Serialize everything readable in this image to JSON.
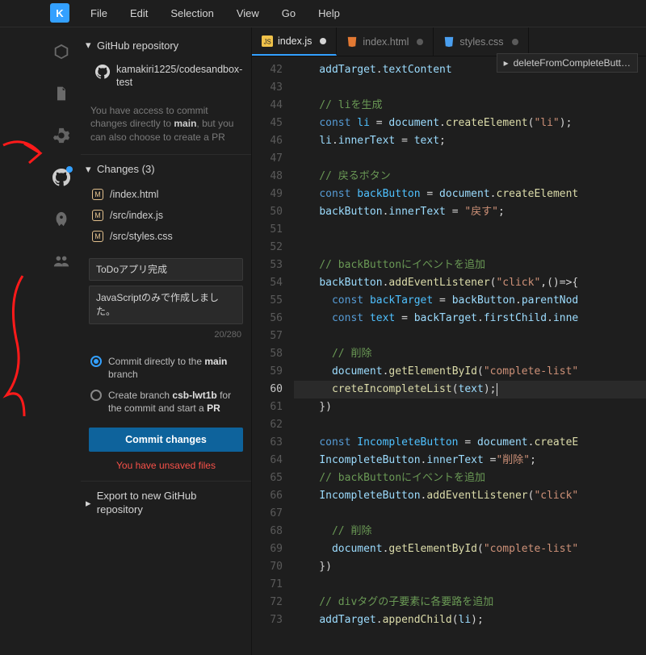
{
  "menubar": {
    "logo": "K",
    "items": [
      "File",
      "Edit",
      "Selection",
      "View",
      "Go",
      "Help"
    ]
  },
  "activity": {
    "icons": [
      {
        "name": "cube-icon"
      },
      {
        "name": "file-icon"
      },
      {
        "name": "gear-icon"
      },
      {
        "name": "github-icon",
        "active": true,
        "notif": true
      },
      {
        "name": "rocket-icon"
      },
      {
        "name": "users-icon"
      }
    ]
  },
  "sidebar": {
    "github_header": "GitHub repository",
    "repo": "kamakiri1225/codesandbox-test",
    "info_pre": "You have access to commit changes directly to ",
    "info_main": "main",
    "info_post": ", but you can also choose to create a PR",
    "changes_header": "Changes (3)",
    "changes": [
      {
        "badge": "M",
        "path": "/index.html"
      },
      {
        "badge": "M",
        "path": "/src/index.js"
      },
      {
        "badge": "M",
        "path": "/src/styles.css"
      }
    ],
    "commit_title": "ToDoアプリ完成",
    "commit_desc": "JavaScriptのみで作成しました。",
    "char_count": "20/280",
    "radio1_pre": "Commit directly to the ",
    "radio1_b": "main",
    "radio1_post": " branch",
    "radio2_pre": "Create branch ",
    "radio2_b": "csb-lwt1b",
    "radio2_mid": " for the commit and start a ",
    "radio2_b2": "PR",
    "commit_btn": "Commit changes",
    "warn": "You have unsaved files",
    "export_header": "Export to new GitHub repository"
  },
  "tabs": [
    {
      "label": "index.js",
      "active": true,
      "kind": "js"
    },
    {
      "label": "index.html",
      "active": false,
      "kind": "html"
    },
    {
      "label": "styles.css",
      "active": false,
      "kind": "css"
    }
  ],
  "breadcrumb": "deleteFromCompleteButt…",
  "code": {
    "start": 42,
    "active_line": 60,
    "lines": [
      {
        "n": 42,
        "t": [
          {
            "c": "var",
            "s": "    addTarget"
          },
          {
            "c": "plain",
            "s": "."
          },
          {
            "c": "var",
            "s": "textContent"
          }
        ]
      },
      {
        "n": 43,
        "t": []
      },
      {
        "n": 44,
        "t": [
          {
            "c": "cmt",
            "s": "    // liを生成"
          }
        ]
      },
      {
        "n": 45,
        "t": [
          {
            "c": "plain",
            "s": "    "
          },
          {
            "c": "kw2",
            "s": "const "
          },
          {
            "c": "obj",
            "s": "li"
          },
          {
            "c": "plain",
            "s": " = "
          },
          {
            "c": "var",
            "s": "document"
          },
          {
            "c": "plain",
            "s": "."
          },
          {
            "c": "fn",
            "s": "createElement"
          },
          {
            "c": "plain",
            "s": "("
          },
          {
            "c": "str",
            "s": "\"li\""
          },
          {
            "c": "plain",
            "s": ");"
          }
        ]
      },
      {
        "n": 46,
        "t": [
          {
            "c": "plain",
            "s": "    "
          },
          {
            "c": "var",
            "s": "li"
          },
          {
            "c": "plain",
            "s": "."
          },
          {
            "c": "var",
            "s": "innerText"
          },
          {
            "c": "plain",
            "s": " = "
          },
          {
            "c": "var",
            "s": "text"
          },
          {
            "c": "plain",
            "s": ";"
          }
        ]
      },
      {
        "n": 47,
        "t": []
      },
      {
        "n": 48,
        "t": [
          {
            "c": "cmt",
            "s": "    // 戻るボタン"
          }
        ]
      },
      {
        "n": 49,
        "t": [
          {
            "c": "plain",
            "s": "    "
          },
          {
            "c": "kw2",
            "s": "const "
          },
          {
            "c": "obj",
            "s": "backButton"
          },
          {
            "c": "plain",
            "s": " = "
          },
          {
            "c": "var",
            "s": "document"
          },
          {
            "c": "plain",
            "s": "."
          },
          {
            "c": "fn",
            "s": "createElement"
          }
        ]
      },
      {
        "n": 50,
        "t": [
          {
            "c": "plain",
            "s": "    "
          },
          {
            "c": "var",
            "s": "backButton"
          },
          {
            "c": "plain",
            "s": "."
          },
          {
            "c": "var",
            "s": "innerText"
          },
          {
            "c": "plain",
            "s": " = "
          },
          {
            "c": "str",
            "s": "\"戻す\""
          },
          {
            "c": "plain",
            "s": ";"
          }
        ]
      },
      {
        "n": 51,
        "t": []
      },
      {
        "n": 52,
        "t": []
      },
      {
        "n": 53,
        "t": [
          {
            "c": "cmt",
            "s": "    // backButtonにイベントを追加"
          }
        ]
      },
      {
        "n": 54,
        "t": [
          {
            "c": "plain",
            "s": "    "
          },
          {
            "c": "var",
            "s": "backButton"
          },
          {
            "c": "plain",
            "s": "."
          },
          {
            "c": "fn",
            "s": "addEventListener"
          },
          {
            "c": "plain",
            "s": "("
          },
          {
            "c": "str",
            "s": "\"click\""
          },
          {
            "c": "plain",
            "s": ",()=>{"
          }
        ]
      },
      {
        "n": 55,
        "t": [
          {
            "c": "plain",
            "s": "      "
          },
          {
            "c": "kw2",
            "s": "const "
          },
          {
            "c": "obj",
            "s": "backTarget"
          },
          {
            "c": "plain",
            "s": " = "
          },
          {
            "c": "var",
            "s": "backButton"
          },
          {
            "c": "plain",
            "s": "."
          },
          {
            "c": "var",
            "s": "parentNod"
          }
        ]
      },
      {
        "n": 56,
        "t": [
          {
            "c": "plain",
            "s": "      "
          },
          {
            "c": "kw2",
            "s": "const "
          },
          {
            "c": "obj",
            "s": "text"
          },
          {
            "c": "plain",
            "s": " = "
          },
          {
            "c": "var",
            "s": "backTarget"
          },
          {
            "c": "plain",
            "s": "."
          },
          {
            "c": "var",
            "s": "firstChild"
          },
          {
            "c": "plain",
            "s": "."
          },
          {
            "c": "var",
            "s": "inne"
          }
        ]
      },
      {
        "n": 57,
        "t": []
      },
      {
        "n": 58,
        "t": [
          {
            "c": "cmt",
            "s": "      // 削除"
          }
        ]
      },
      {
        "n": 59,
        "t": [
          {
            "c": "plain",
            "s": "      "
          },
          {
            "c": "var",
            "s": "document"
          },
          {
            "c": "plain",
            "s": "."
          },
          {
            "c": "fn",
            "s": "getElementById"
          },
          {
            "c": "plain",
            "s": "("
          },
          {
            "c": "str",
            "s": "\"complete-list\""
          }
        ]
      },
      {
        "n": 60,
        "t": [
          {
            "c": "plain",
            "s": "      "
          },
          {
            "c": "fn",
            "s": "creteIncompleteList"
          },
          {
            "c": "plain",
            "s": "("
          },
          {
            "c": "var",
            "s": "text"
          },
          {
            "c": "plain",
            "s": ");"
          },
          {
            "c": "cursor",
            "s": ""
          }
        ]
      },
      {
        "n": 61,
        "t": [
          {
            "c": "plain",
            "s": "    })"
          }
        ]
      },
      {
        "n": 62,
        "t": []
      },
      {
        "n": 63,
        "t": [
          {
            "c": "plain",
            "s": "    "
          },
          {
            "c": "kw2",
            "s": "const "
          },
          {
            "c": "obj",
            "s": "IncompleteButton"
          },
          {
            "c": "plain",
            "s": " = "
          },
          {
            "c": "var",
            "s": "document"
          },
          {
            "c": "plain",
            "s": "."
          },
          {
            "c": "fn",
            "s": "createE"
          }
        ]
      },
      {
        "n": 64,
        "t": [
          {
            "c": "plain",
            "s": "    "
          },
          {
            "c": "var",
            "s": "IncompleteButton"
          },
          {
            "c": "plain",
            "s": "."
          },
          {
            "c": "var",
            "s": "innerText"
          },
          {
            "c": "plain",
            "s": " ="
          },
          {
            "c": "str",
            "s": "\"削除\""
          },
          {
            "c": "plain",
            "s": ";"
          }
        ]
      },
      {
        "n": 65,
        "t": [
          {
            "c": "cmt",
            "s": "    // backButtonにイベントを追加"
          }
        ]
      },
      {
        "n": 66,
        "t": [
          {
            "c": "plain",
            "s": "    "
          },
          {
            "c": "var",
            "s": "IncompleteButton"
          },
          {
            "c": "plain",
            "s": "."
          },
          {
            "c": "fn",
            "s": "addEventListener"
          },
          {
            "c": "plain",
            "s": "("
          },
          {
            "c": "str",
            "s": "\"click\""
          }
        ]
      },
      {
        "n": 67,
        "t": []
      },
      {
        "n": 68,
        "t": [
          {
            "c": "cmt",
            "s": "      // 削除"
          }
        ]
      },
      {
        "n": 69,
        "t": [
          {
            "c": "plain",
            "s": "      "
          },
          {
            "c": "var",
            "s": "document"
          },
          {
            "c": "plain",
            "s": "."
          },
          {
            "c": "fn",
            "s": "getElementById"
          },
          {
            "c": "plain",
            "s": "("
          },
          {
            "c": "str",
            "s": "\"complete-list\""
          }
        ]
      },
      {
        "n": 70,
        "t": [
          {
            "c": "plain",
            "s": "    })"
          }
        ]
      },
      {
        "n": 71,
        "t": []
      },
      {
        "n": 72,
        "t": [
          {
            "c": "cmt",
            "s": "    // divタグの子要素に各要路を追加"
          }
        ]
      },
      {
        "n": 73,
        "t": [
          {
            "c": "plain",
            "s": "    "
          },
          {
            "c": "var",
            "s": "addTarget"
          },
          {
            "c": "plain",
            "s": "."
          },
          {
            "c": "fn",
            "s": "appendChild"
          },
          {
            "c": "plain",
            "s": "("
          },
          {
            "c": "var",
            "s": "li"
          },
          {
            "c": "plain",
            "s": ");"
          }
        ]
      }
    ]
  }
}
